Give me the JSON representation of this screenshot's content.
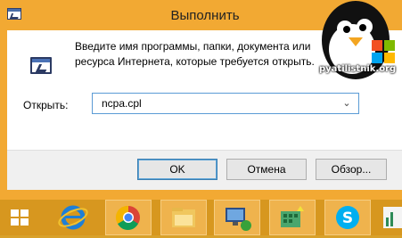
{
  "window": {
    "title": "Выполнить",
    "description": "Введите имя программы, папки, документа или ресурса Интернета, которые требуется открыть.",
    "open_label": "Открыть:",
    "open_value": "ncpa.cpl",
    "dropdown_arrow": "⌄"
  },
  "buttons": {
    "ok": "OK",
    "cancel": "Отмена",
    "browse": "Обзор..."
  },
  "watermark": "pyatilistnik.org",
  "taskbar": {
    "items": [
      "windows-start",
      "internet-explorer",
      "chrome",
      "file-explorer",
      "network-computer",
      "network-adapters",
      "skype",
      "chart-app"
    ]
  },
  "colors": {
    "desktop": "#d9a12b",
    "window_frame": "#f2a933",
    "taskbar": "#d7971f",
    "combo_border": "#5b9bd5"
  }
}
